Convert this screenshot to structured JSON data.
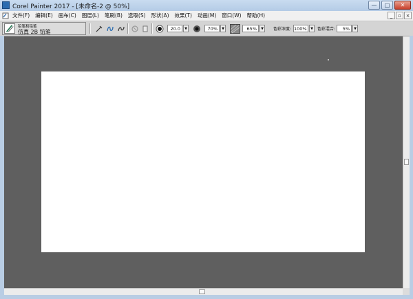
{
  "window": {
    "title": "Corel Painter 2017 - [未命名-2 @ 50%]",
    "buttons": {
      "minimize": "—",
      "maximize": "□",
      "close": "✕"
    }
  },
  "menu": {
    "items": [
      "文件(F)",
      "编辑(E)",
      "画布(C)",
      "图层(L)",
      "笔刷(B)",
      "选取(S)",
      "形状(A)",
      "效果(T)",
      "动画(M)",
      "窗口(W)",
      "帮助(H)"
    ],
    "doc_buttons": {
      "minimize": "_",
      "restore": "▫",
      "close": "×"
    }
  },
  "property_bar": {
    "brush_category": "铅笔和铅笔",
    "brush_variant": "仿真 2B 铅笔",
    "size_value": "20.0",
    "opacity_value": "70%",
    "grain_value": "65%",
    "resat_label": "色彩浓度:",
    "resat_value": "100%",
    "bleed_label": "色彩混合:",
    "bleed_value": "5%",
    "dropdown_glyph": "▼"
  },
  "colors": {
    "titlebar": "#b4cbe6",
    "canvas_background": "#5f5f5f",
    "paper": "#ffffff",
    "property_bar": "#d4d4d4"
  },
  "icons": [
    "app-icon",
    "document-icon",
    "brush-thumbnail-icon",
    "brush-tracking-icon",
    "stroke-freehand-icon",
    "stroke-straight-icon",
    "reset-tool-icon",
    "eraser-icon",
    "size-dab-icon",
    "opacity-dab-icon",
    "grain-texture-icon"
  ]
}
